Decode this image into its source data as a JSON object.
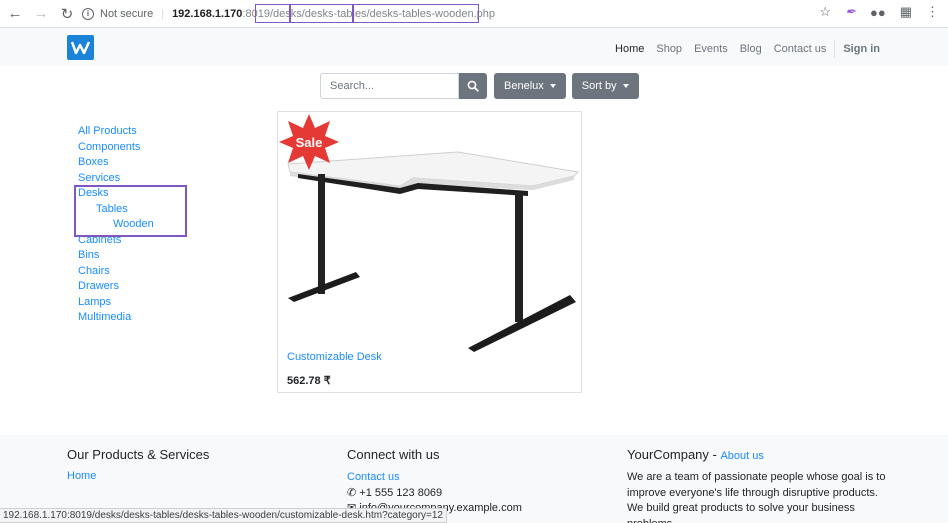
{
  "browser": {
    "security": "Not secure",
    "url_host": "192.168.1.170",
    "url_port": ":8019",
    "url_path_1": "/desks",
    "url_path_2": "/desks-tables",
    "url_path_3": "/desks-tables-wooden.php"
  },
  "header": {
    "nav": [
      "Home",
      "Shop",
      "Events",
      "Blog",
      "Contact us"
    ],
    "signin": "Sign in"
  },
  "search": {
    "placeholder": "Search...",
    "pricelist": "Benelux",
    "sort": "Sort by"
  },
  "categories": [
    {
      "label": "All Products",
      "level": 0
    },
    {
      "label": "Components",
      "level": 0
    },
    {
      "label": "Boxes",
      "level": 0
    },
    {
      "label": "Services",
      "level": 0
    },
    {
      "label": "Desks",
      "level": 0
    },
    {
      "label": "Tables",
      "level": 1
    },
    {
      "label": "Wooden",
      "level": 2
    },
    {
      "label": "Cabinets",
      "level": 0
    },
    {
      "label": "Bins",
      "level": 0
    },
    {
      "label": "Chairs",
      "level": 0
    },
    {
      "label": "Drawers",
      "level": 0
    },
    {
      "label": "Lamps",
      "level": 0
    },
    {
      "label": "Multimedia",
      "level": 0
    }
  ],
  "product": {
    "badge": "Sale",
    "name": "Customizable Desk",
    "price": "562.78 ₹"
  },
  "footer": {
    "col1_title": "Our Products & Services",
    "col1_link": "Home",
    "col2_title": "Connect with us",
    "col2_link": "Contact us",
    "phone": "+1 555 123 8069",
    "email": "info@yourcompany.example.com",
    "col3_title": "YourCompany",
    "col3_sep": " - ",
    "col3_link": "About us",
    "about_text": "We are a team of passionate people whose goal is to improve everyone's life through disruptive products. We build great products to solve your business problems."
  },
  "status_url": "192.168.1.170:8019/desks/desks-tables/desks-tables-wooden/customizable-desk.htm?category=12",
  "colors": {
    "link": "#1a8cff",
    "button": "#6c757d",
    "highlight": "#7e57c2",
    "sale": "#e53935",
    "logo": "#1c84d8"
  }
}
